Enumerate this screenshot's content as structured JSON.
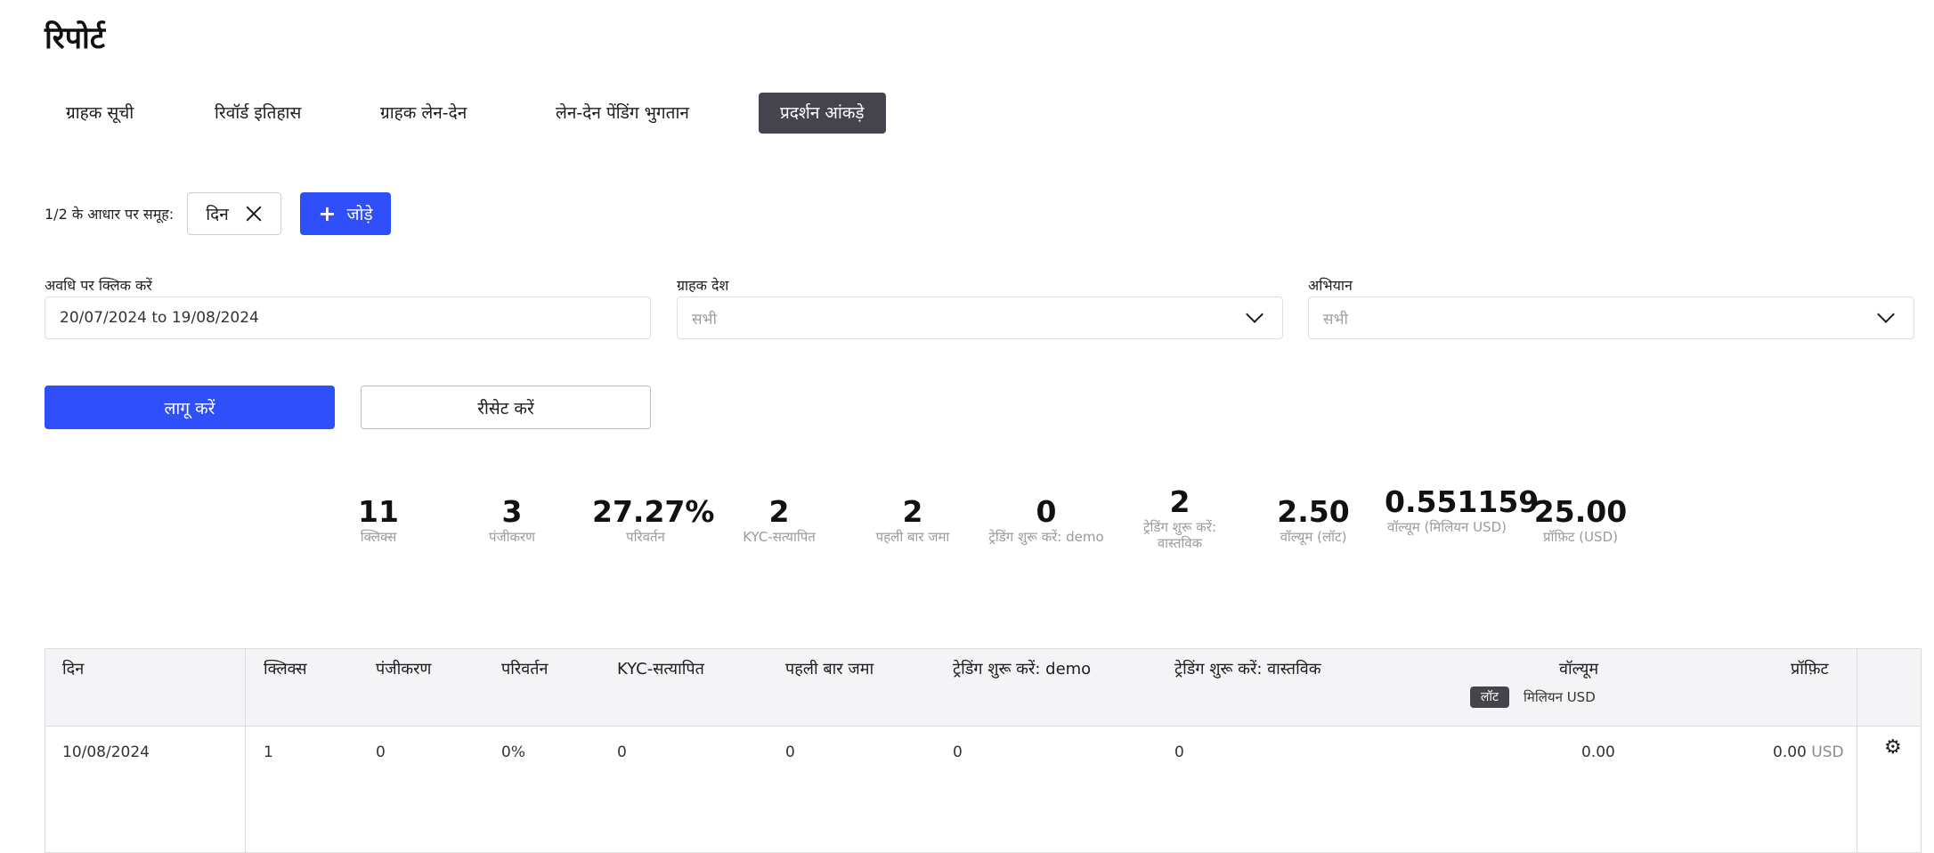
{
  "page": {
    "title": "रिपोर्ट"
  },
  "tabs": [
    {
      "label": "ग्राहक सूची"
    },
    {
      "label": "रिवॉर्ड इतिहास"
    },
    {
      "label": "ग्राहक लेन-देन"
    },
    {
      "label": "लेन-देन पेंडिंग भुगतान"
    },
    {
      "label": "प्रदर्शन आंकड़े",
      "active": true
    }
  ],
  "group_by": {
    "label": "1/2 के आधार पर समूह:",
    "chip": "दिन",
    "add_label": "जोड़े",
    "add_icon": "plus-icon"
  },
  "filters": {
    "period": {
      "label": "अवधि पर क्लिक करें",
      "value": "20/07/2024 to 19/08/2024"
    },
    "country": {
      "label": "ग्राहक देश",
      "placeholder": "सभी"
    },
    "campaign": {
      "label": "अभियान",
      "placeholder": "सभी"
    }
  },
  "actions": {
    "apply": "लागू करें",
    "reset": "रीसेट करें"
  },
  "stats": [
    {
      "value": "11",
      "label": "क्लिक्स"
    },
    {
      "value": "3",
      "label": "पंजीकरण"
    },
    {
      "value": "27.27%",
      "label": "परिवर्तन"
    },
    {
      "value": "2",
      "label": "KYC-सत्यापित"
    },
    {
      "value": "2",
      "label": "पहली बार जमा"
    },
    {
      "value": "0",
      "label": "ट्रेडिंग शुरू करें: demo"
    },
    {
      "value": "2",
      "label": "ट्रेडिंग शुरू करें: वास्तविक"
    },
    {
      "value": "2.50",
      "label": "वॉल्यूम (लॉट)"
    },
    {
      "value": "0.551159",
      "label": "वॉल्यूम (मिलियन USD)"
    },
    {
      "value": "25.00",
      "label": "प्रॉफ़िट (USD)"
    }
  ],
  "table": {
    "headers": {
      "day": "दिन",
      "clicks": "क्लिक्स",
      "registrations": "पंजीकरण",
      "conversion": "परिवर्तन",
      "kyc": "KYC-सत्यापित",
      "first_deposit": "पहली बार जमा",
      "trading_demo": "ट्रेडिंग शुरू करें: demo",
      "trading_real": "ट्रेडिंग शुरू करें: वास्तविक",
      "volume": "वॉल्यूम",
      "profit": "प्रॉफ़िट"
    },
    "volume_toggle": {
      "lots": "लॉट",
      "million_usd": "मिलियन USD"
    },
    "rows": [
      {
        "day": "10/08/2024",
        "clicks": "1",
        "registrations": "0",
        "conversion": "0%",
        "kyc": "0",
        "first_deposit": "0",
        "trading_demo": "0",
        "trading_real": "0",
        "volume": "0.00",
        "profit": "0.00",
        "profit_unit": "USD"
      }
    ],
    "settings_icon": "gear-icon"
  },
  "colors": {
    "primary": "#2f4ffb",
    "active_tab": "#45434b"
  }
}
